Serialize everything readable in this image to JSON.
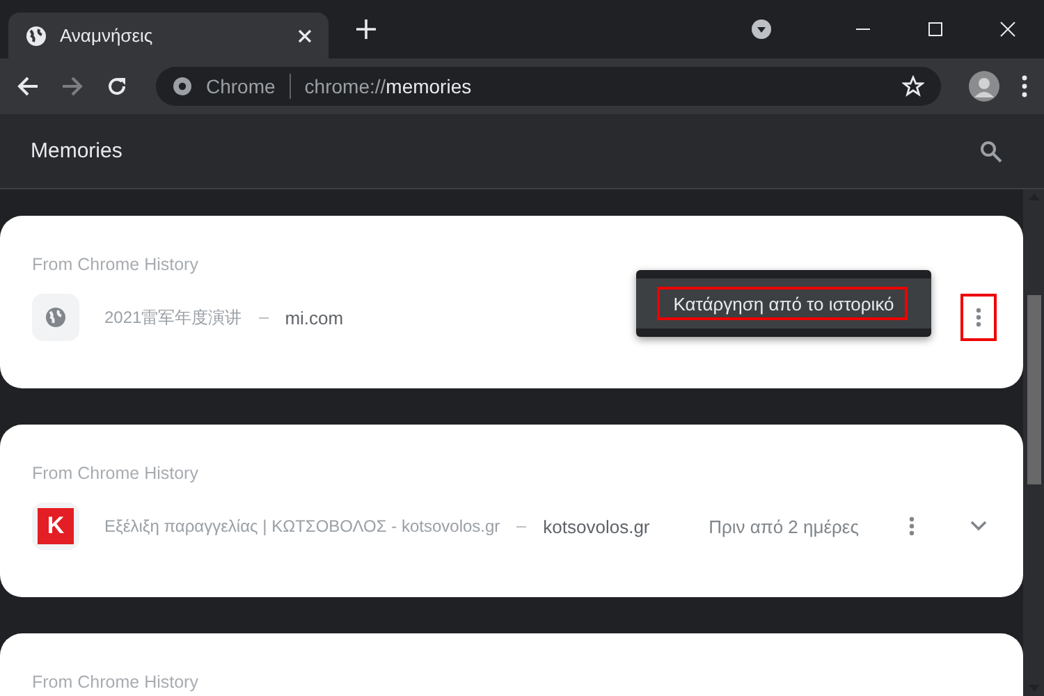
{
  "tab": {
    "title": "Αναμνήσεις"
  },
  "address_bar": {
    "origin": "Chrome",
    "url": "chrome://**memories**"
  },
  "header": {
    "title": "Memories"
  },
  "cards": [
    {
      "source": "From Chrome History",
      "kind": "globe",
      "title": "2021雷军年度演讲",
      "domain": "mi.com",
      "menu_open": true,
      "menu_item": "Κατάργηση από το ιστορικό",
      "highlighted": true,
      "expandable": false
    },
    {
      "source": "From Chrome History",
      "kind": "logo",
      "logo_letter": "K",
      "title": "Εξέλιξη παραγγελίας | ΚΩΤΣΟΒΟΛΟΣ - kotsovolos.gr",
      "domain": "kotsovolos.gr",
      "time": "Πριν από 2 ημέρες",
      "menu_open": false,
      "highlighted": false,
      "expandable": true
    },
    {
      "source": "From Chrome History"
    }
  ]
}
